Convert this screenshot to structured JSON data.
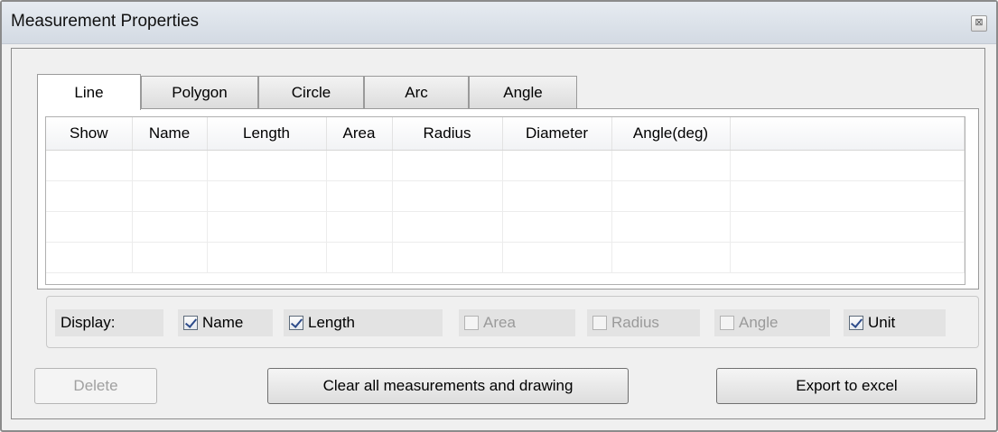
{
  "window": {
    "title": "Measurement Properties",
    "close_glyph": "⊠"
  },
  "tabs": [
    {
      "label": "Line",
      "active": true
    },
    {
      "label": "Polygon",
      "active": false
    },
    {
      "label": "Circle",
      "active": false
    },
    {
      "label": "Arc",
      "active": false
    },
    {
      "label": "Angle",
      "active": false
    }
  ],
  "grid": {
    "columns": [
      "Show",
      "Name",
      "Length",
      "Area",
      "Radius",
      "Diameter",
      "Angle(deg)",
      ""
    ],
    "rows": [
      [
        "",
        "",
        "",
        "",
        "",
        "",
        "",
        ""
      ],
      [
        "",
        "",
        "",
        "",
        "",
        "",
        "",
        ""
      ],
      [
        "",
        "",
        "",
        "",
        "",
        "",
        "",
        ""
      ],
      [
        "",
        "",
        "",
        "",
        "",
        "",
        "",
        ""
      ]
    ]
  },
  "display": {
    "label": "Display:",
    "options": [
      {
        "label": "Name",
        "checked": true,
        "enabled": true
      },
      {
        "label": "Length",
        "checked": true,
        "enabled": true
      },
      {
        "label": "Area",
        "checked": false,
        "enabled": false
      },
      {
        "label": "Radius",
        "checked": false,
        "enabled": false
      },
      {
        "label": "Angle",
        "checked": false,
        "enabled": false
      },
      {
        "label": "Unit",
        "checked": true,
        "enabled": true
      }
    ]
  },
  "buttons": {
    "delete": "Delete",
    "clear": "Clear all measurements and drawing",
    "export": "Export to excel"
  }
}
